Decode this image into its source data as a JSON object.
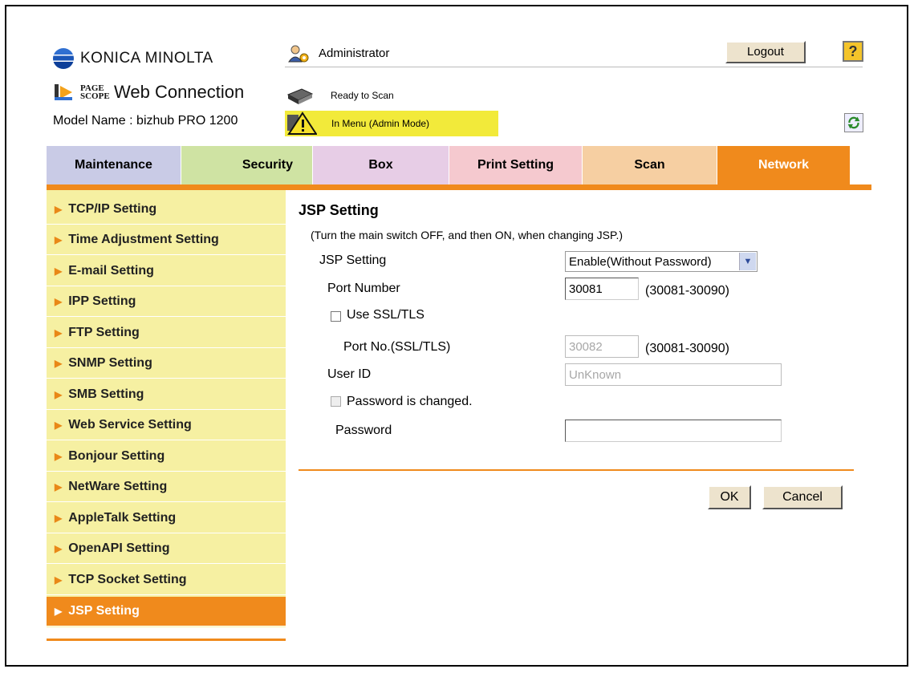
{
  "header": {
    "brand": "KONICA MINOLTA",
    "product_small": "PAGE SCOPE",
    "product": "Web Connection",
    "model": "Model Name : bizhub PRO 1200",
    "user": "Administrator",
    "logout_label": "Logout",
    "help_label": "?",
    "status_ready": "Ready to Scan",
    "status_warning": "In Menu (Admin Mode)"
  },
  "tabs": [
    {
      "label": "Maintenance",
      "color": "#c9cbe6"
    },
    {
      "label": "Security",
      "color": "#cfe3a3"
    },
    {
      "label": "Box",
      "color": "#e7cde6"
    },
    {
      "label": "Print Setting",
      "color": "#f5c9cf"
    },
    {
      "label": "Scan",
      "color": "#f6cfa2"
    },
    {
      "label": "Network",
      "color": "#f08a1c"
    }
  ],
  "sidebar": {
    "items": [
      {
        "label": "TCP/IP Setting"
      },
      {
        "label": "Time Adjustment Setting"
      },
      {
        "label": "E-mail Setting"
      },
      {
        "label": "IPP Setting"
      },
      {
        "label": "FTP Setting"
      },
      {
        "label": "SNMP Setting"
      },
      {
        "label": "SMB Setting"
      },
      {
        "label": "Web Service Setting"
      },
      {
        "label": "Bonjour Setting"
      },
      {
        "label": "NetWare Setting"
      },
      {
        "label": "AppleTalk Setting"
      },
      {
        "label": "OpenAPI Setting"
      },
      {
        "label": "TCP Socket Setting"
      },
      {
        "label": "JSP Setting"
      }
    ],
    "active_index": 13
  },
  "main": {
    "title": "JSP Setting",
    "note": "(Turn the main switch OFF, and then ON, when changing JSP.)",
    "jsp_setting_label": "JSP Setting",
    "jsp_setting_value": "Enable(Without Password)",
    "port_number_label": "Port Number",
    "port_number_value": "30081",
    "port_number_range": "(30081-30090)",
    "use_ssl_label": "Use SSL/TLS",
    "port_ssl_label": "Port No.(SSL/TLS)",
    "port_ssl_value": "30082",
    "port_ssl_range": "(30081-30090)",
    "user_id_label": "User ID",
    "user_id_value": "UnKnown",
    "password_changed_label": "Password is changed.",
    "password_label": "Password",
    "password_value": "",
    "ok_label": "OK",
    "cancel_label": "Cancel"
  }
}
